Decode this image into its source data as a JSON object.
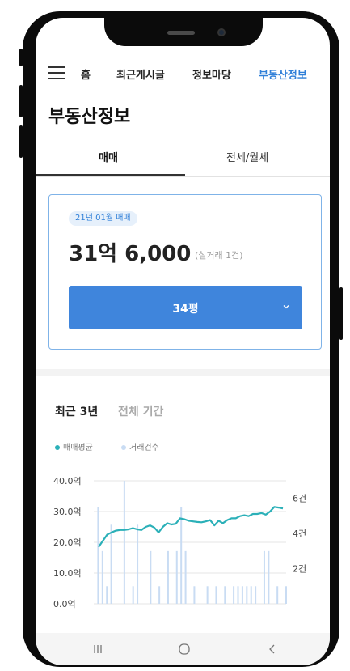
{
  "nav": {
    "items": [
      {
        "label": "홈",
        "active": false
      },
      {
        "label": "최근게시글",
        "active": false
      },
      {
        "label": "정보마당",
        "active": false
      },
      {
        "label": "부동산정보",
        "active": true
      }
    ]
  },
  "page": {
    "title": "부동산정보"
  },
  "tabs": [
    {
      "label": "매매",
      "active": true
    },
    {
      "label": "전세/월세",
      "active": false
    }
  ],
  "card": {
    "badge": "21년 01월 매매",
    "price": "31억 6,000",
    "price_sub": "(실거래 1건)",
    "size_select": "34평"
  },
  "period": {
    "recent": "최근 3년",
    "all": "전체 기간"
  },
  "legend": {
    "avg": {
      "label": "매매평균",
      "color": "#2bb0b8"
    },
    "count": {
      "label": "거래건수",
      "color": "#c9dcf3"
    }
  },
  "chart_data": {
    "type": "line",
    "title": "",
    "y_left_ticks": [
      "0.0억",
      "10.0억",
      "20.0억",
      "30.0억",
      "40.0억"
    ],
    "y_left_range": [
      0,
      40
    ],
    "y_right_ticks": [
      "2건",
      "4건",
      "6건"
    ],
    "y_right_range": [
      0,
      7
    ],
    "grid": true,
    "series": [
      {
        "name": "매매평균",
        "color": "#2bb0b8",
        "values": [
          18.5,
          20.5,
          22.5,
          23.2,
          23.8,
          24.0,
          24.0,
          24.2,
          24.6,
          24.2,
          24.0,
          25.0,
          25.5,
          24.8,
          23.2,
          25.0,
          26.2,
          25.8,
          26.0,
          27.8,
          27.5,
          27.0,
          26.8,
          26.6,
          26.5,
          26.8,
          27.2,
          25.5,
          27.0,
          26.2,
          27.2,
          27.8,
          27.8,
          28.5,
          28.8,
          28.5,
          29.2,
          29.2,
          29.5,
          29.0,
          30.0,
          31.5,
          31.3,
          31.0
        ]
      },
      {
        "name": "거래건수",
        "color": "#c9dcf3",
        "values": [
          0,
          5.5,
          3,
          1,
          4.5,
          0,
          0,
          7,
          0,
          1,
          4.5,
          0,
          0,
          3,
          0,
          1,
          0,
          3,
          0,
          3,
          5.5,
          3,
          0,
          1,
          0,
          0,
          1,
          0,
          1,
          0,
          1,
          0,
          1,
          1,
          1,
          1,
          1,
          1,
          0,
          3,
          3,
          0,
          1,
          0,
          1
        ]
      }
    ]
  }
}
